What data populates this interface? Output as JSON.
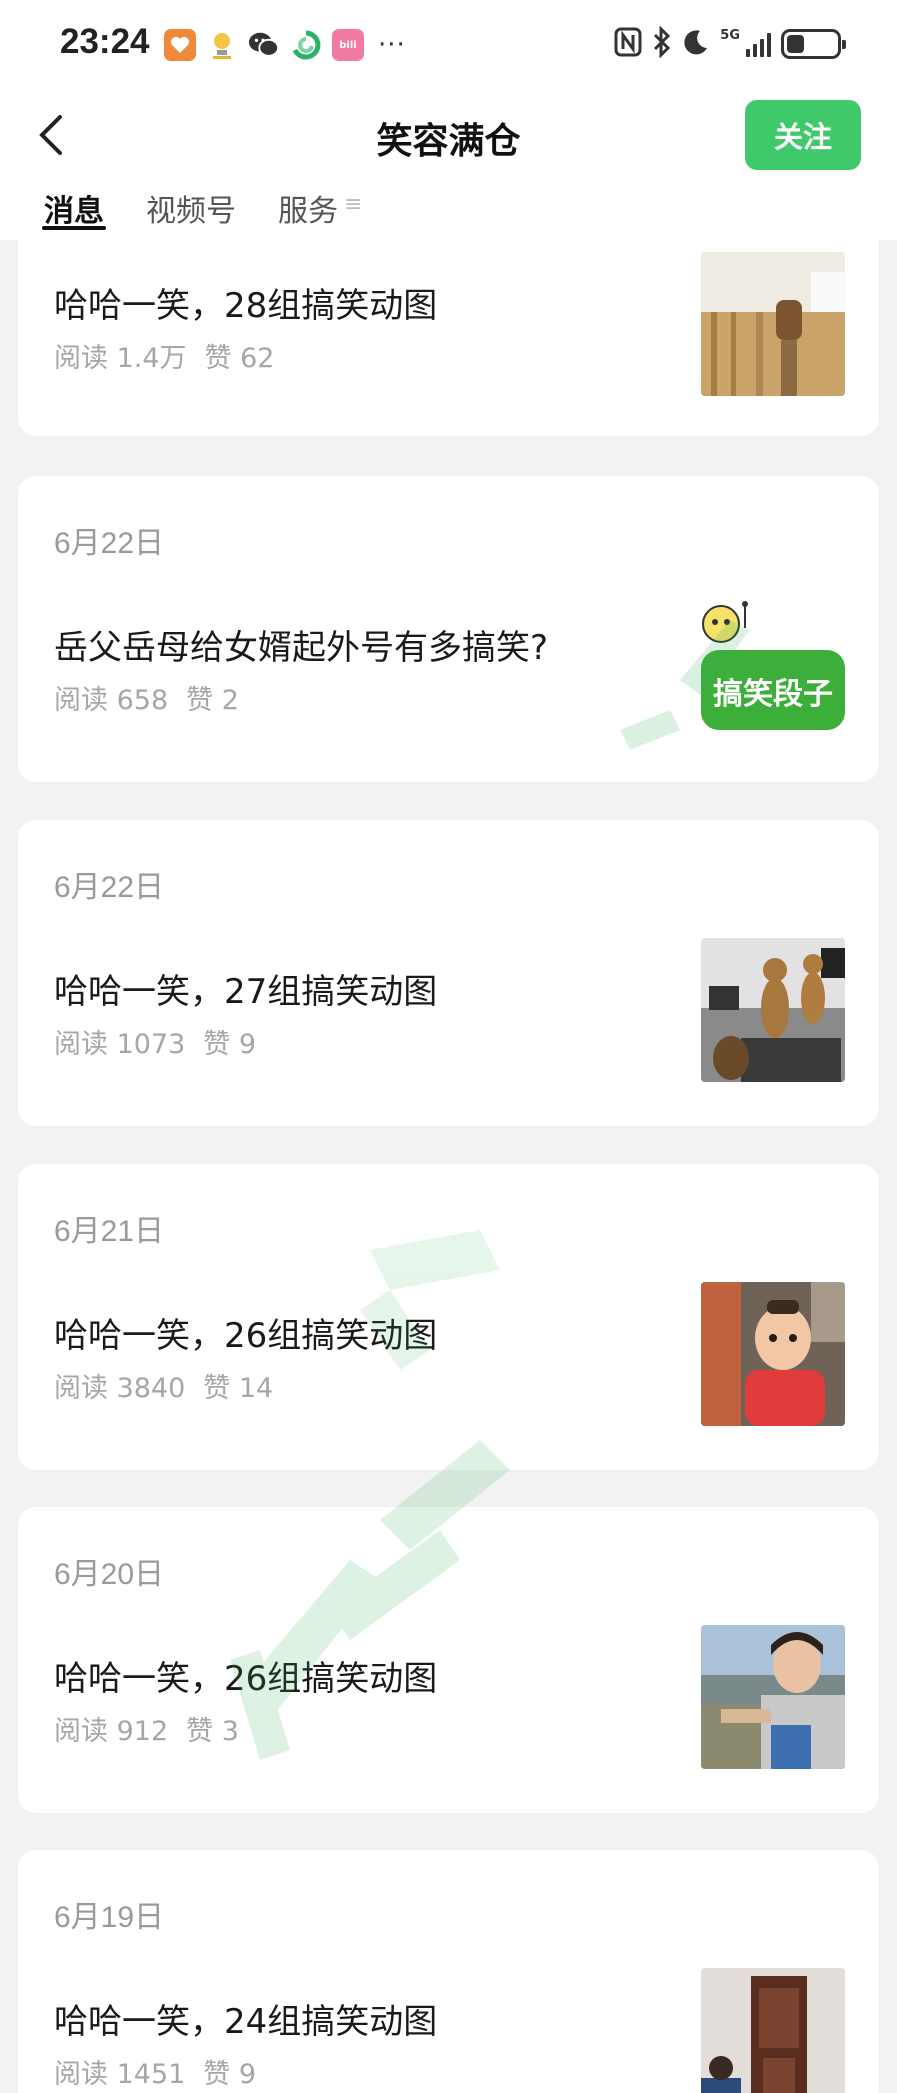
{
  "status_bar": {
    "time": "23:24",
    "dots": "···",
    "network": "5G",
    "bili_text": "bili"
  },
  "nav": {
    "title": "笑容满仓",
    "follow_label": "关注"
  },
  "tabs": [
    {
      "label": "消息",
      "active": true
    },
    {
      "label": "视频号",
      "active": false
    },
    {
      "label": "服务",
      "active": false
    }
  ],
  "tab_more": "≡",
  "articles": [
    {
      "date": "",
      "title": "哈哈一笑，28组搞笑动图",
      "reads": "阅读 1.4万",
      "likes": "赞 62"
    },
    {
      "date": "6月22日",
      "title": "岳父岳母给女婿起外号有多搞笑?",
      "reads": "阅读 658",
      "likes": "赞 2",
      "thumb_text": "搞笑段子"
    },
    {
      "date": "6月22日",
      "title": "哈哈一笑，27组搞笑动图",
      "reads": "阅读 1073",
      "likes": "赞 9"
    },
    {
      "date": "6月21日",
      "title": "哈哈一笑，26组搞笑动图",
      "reads": "阅读 3840",
      "likes": "赞 14"
    },
    {
      "date": "6月20日",
      "title": "哈哈一笑，26组搞笑动图",
      "reads": "阅读 912",
      "likes": "赞 3"
    },
    {
      "date": "6月19日",
      "title": "哈哈一笑，24组搞笑动图",
      "reads": "阅读 1451",
      "likes": "赞 9"
    }
  ],
  "colors": {
    "accent": "#3fc96a",
    "background": "#f2f2f2",
    "meta_text": "#a6a6a6"
  }
}
